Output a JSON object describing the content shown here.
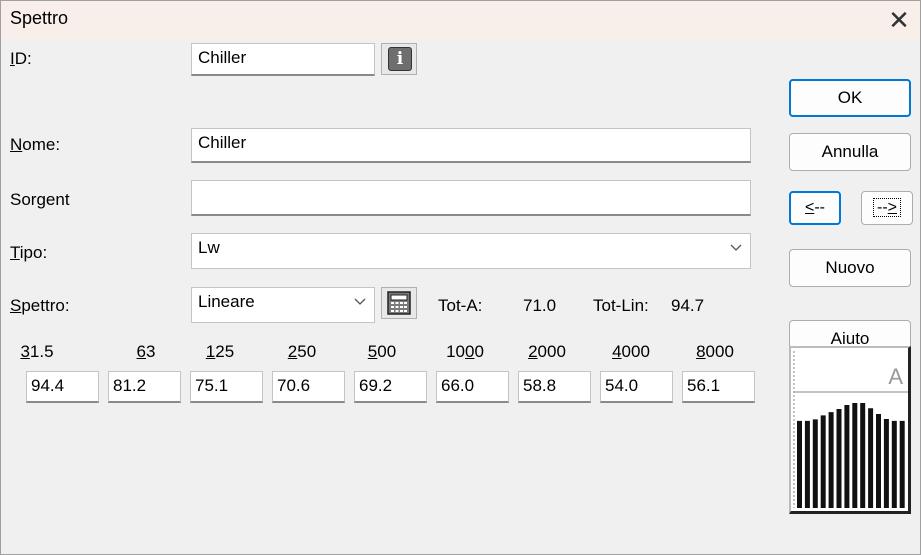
{
  "window": {
    "title": "Spettro",
    "close_glyph": "✕"
  },
  "form": {
    "id": {
      "label_prefix": "",
      "label_accel": "I",
      "label_rest": "D:",
      "value": "Chiller"
    },
    "nome": {
      "label_accel": "N",
      "label_rest": "ome:",
      "value": "Chiller"
    },
    "sorgente": {
      "label": "Sorgent",
      "value": ""
    },
    "tipo": {
      "label_accel": "T",
      "label_rest": "ipo:",
      "value": "Lw"
    },
    "spettro": {
      "label_accel": "S",
      "label_rest": "pettro:",
      "value": "Lineare"
    },
    "tot_a_label": "Tot-A:",
    "tot_a_value": "71.0",
    "tot_lin_label": "Tot-Lin:",
    "tot_lin_value": "94.7"
  },
  "bands": [
    {
      "accel": "3",
      "rest": "1.5",
      "value": "94.4"
    },
    {
      "accel": "6",
      "rest": "3",
      "value": "81.2"
    },
    {
      "accel": "1",
      "rest": "25",
      "value": "75.1"
    },
    {
      "accel": "2",
      "rest": "50",
      "value": "70.6"
    },
    {
      "accel": "5",
      "rest": "00",
      "value": "69.2"
    },
    {
      "accel": "1",
      "rest": "0",
      "accel2": "0",
      "rest2": "0",
      "value": "66.0"
    },
    {
      "accel": "2",
      "rest": "000",
      "value": "58.8"
    },
    {
      "accel": "4",
      "rest": "000",
      "value": "54.0"
    },
    {
      "accel": "8",
      "rest": "000",
      "value": "56.1"
    }
  ],
  "buttons": {
    "ok": "OK",
    "annulla": "Annulla",
    "prev_accel": "<",
    "prev_rest": "--",
    "next_rest": "--",
    "next_accel": ">",
    "nuovo": "Nuovo",
    "aiuto": "Aiuto"
  },
  "preview": {
    "weighting_letter": "A"
  },
  "icons": {
    "info": "info-icon",
    "calculator": "calculator-icon",
    "close": "close-icon",
    "chevron": "chevron-down-icon"
  }
}
